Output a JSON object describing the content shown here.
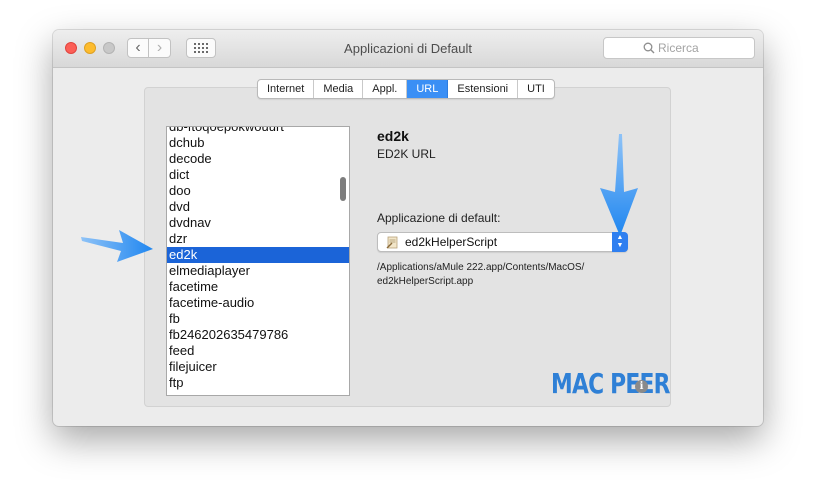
{
  "window": {
    "title": "Applicazioni di Default",
    "back_glyph": "‹",
    "forward_glyph": "›",
    "grid_icon": "show-all-grid-icon",
    "search_placeholder": "Ricerca",
    "search_icon": "search-icon"
  },
  "tabs": [
    {
      "label": "Internet",
      "active": false
    },
    {
      "label": "Media",
      "active": false
    },
    {
      "label": "Appl.",
      "active": false
    },
    {
      "label": "URL",
      "active": true
    },
    {
      "label": "Estensioni",
      "active": false
    },
    {
      "label": "UTI",
      "active": false
    }
  ],
  "url_schemes": {
    "partial_top": "db-ftoqoepokwouurt",
    "items": [
      "dchub",
      "decode",
      "dict",
      "doo",
      "dvd",
      "dvdnav",
      "dzr",
      "ed2k",
      "elmediaplayer",
      "facetime",
      "facetime-audio",
      "fb",
      "fb246202635479786",
      "feed",
      "filejuicer",
      "ftp"
    ],
    "selected": "ed2k"
  },
  "detail": {
    "scheme": "ed2k",
    "description": "ED2K URL",
    "default_app_label": "Applicazione di default:",
    "default_app": "ed2kHelperScript",
    "app_icon": "script-app-icon",
    "app_path_line1": "/Applications/aMule 222.app/Contents/MacOS/",
    "app_path_line2": "ed2kHelperScript.app",
    "info_glyph": "i"
  },
  "watermark": "MAC PEER",
  "colors": {
    "accent": "#3a8ff5",
    "selection": "#1b64d8",
    "annotation_arrow": "#2f8ef0",
    "watermark": "#2f80d6"
  }
}
